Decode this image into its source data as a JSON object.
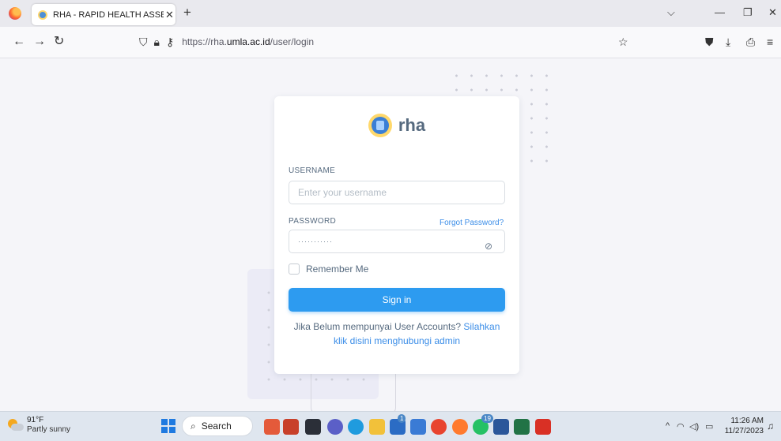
{
  "browser": {
    "tab_title": "RHA - RAPID HEALTH ASSESSM",
    "tab_close": "✕",
    "new_tab": "+",
    "url_prefix": "https://rha.",
    "url_domain": "umla.ac.id",
    "url_path": "/user/login",
    "icons": [
      "firefox-logo",
      "back-arrow",
      "forward-arrow",
      "reload",
      "shield",
      "lock",
      "key",
      "star",
      "pocket",
      "download",
      "share",
      "menu",
      "minimize",
      "restore",
      "close"
    ]
  },
  "brand": {
    "name": "rha"
  },
  "form": {
    "username_label": "USERNAME",
    "username_placeholder": "Enter your username",
    "password_label": "PASSWORD",
    "forgot_link": "Forgot Password?",
    "password_value": "···········",
    "remember_label": "Remember Me",
    "signin_label": "Sign in",
    "register_text": "Jika Belum mempunyai User Accounts? ",
    "register_link": "Silahkan klik disini menghubungi admin"
  },
  "taskbar": {
    "weather_temp": "91°F",
    "weather_desc": "Partly sunny",
    "search_label": "Search",
    "badges": [
      "1",
      "19"
    ],
    "time": "11:26 AM",
    "date": "11/27/2023"
  },
  "colors": {
    "primary": "#2d9bf0",
    "link": "#3c8ee8",
    "page_bg": "#f5f5f9"
  }
}
